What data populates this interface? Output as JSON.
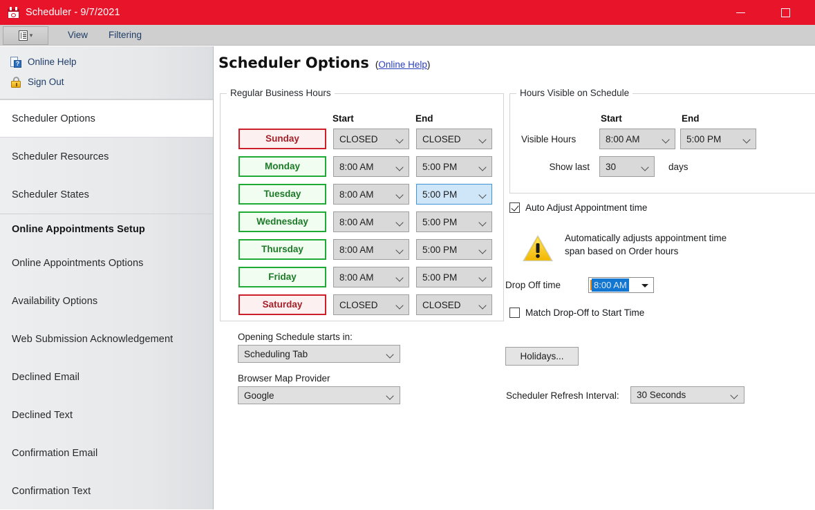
{
  "window": {
    "title": "Scheduler - 9/7/2021",
    "icon": "calendar-icon",
    "minimize_label": "",
    "maximize_label": ""
  },
  "menubar": {
    "app_button_icon": "application-menu-icon",
    "items": [
      {
        "label": "View"
      },
      {
        "label": "Filtering"
      }
    ]
  },
  "sidebar": {
    "quicklinks": [
      {
        "label": "Online Help",
        "icon": "help-document-icon"
      },
      {
        "label": "Sign Out",
        "icon": "padlock-icon"
      }
    ],
    "items": [
      {
        "label": "Scheduler Options",
        "selected": true,
        "header": false
      },
      {
        "label": "Scheduler Resources",
        "selected": false,
        "header": false
      },
      {
        "label": "Scheduler States",
        "selected": false,
        "header": false
      },
      {
        "label": "Online Appointments Setup",
        "selected": false,
        "header": true
      },
      {
        "label": "Online Appointments Options",
        "selected": false,
        "header": false
      },
      {
        "label": "Availability Options",
        "selected": false,
        "header": false
      },
      {
        "label": "Web Submission Acknowledgement",
        "selected": false,
        "header": false
      },
      {
        "label": "Declined Email",
        "selected": false,
        "header": false
      },
      {
        "label": "Declined Text",
        "selected": false,
        "header": false
      },
      {
        "label": "Confirmation Email",
        "selected": false,
        "header": false
      },
      {
        "label": "Confirmation Text",
        "selected": false,
        "header": false
      }
    ]
  },
  "page": {
    "title": "Scheduler Options",
    "help_open_paren": "(",
    "help_link": "Online Help",
    "help_close_paren": ")"
  },
  "business_hours": {
    "legend": "Regular Business Hours",
    "col_start": "Start",
    "col_end": "End",
    "rows": [
      {
        "day": "Sunday",
        "closed": true,
        "start": "CLOSED",
        "end": "CLOSED",
        "end_focused": false
      },
      {
        "day": "Monday",
        "closed": false,
        "start": "8:00 AM",
        "end": "5:00 PM",
        "end_focused": false
      },
      {
        "day": "Tuesday",
        "closed": false,
        "start": "8:00 AM",
        "end": "5:00 PM",
        "end_focused": true
      },
      {
        "day": "Wednesday",
        "closed": false,
        "start": "8:00 AM",
        "end": "5:00 PM",
        "end_focused": false
      },
      {
        "day": "Thursday",
        "closed": false,
        "start": "8:00 AM",
        "end": "5:00 PM",
        "end_focused": false
      },
      {
        "day": "Friday",
        "closed": false,
        "start": "8:00 AM",
        "end": "5:00 PM",
        "end_focused": false
      },
      {
        "day": "Saturday",
        "closed": true,
        "start": "CLOSED",
        "end": "CLOSED",
        "end_focused": false
      }
    ]
  },
  "hours_visible": {
    "legend": "Hours Visible on Schedule",
    "col_start": "Start",
    "col_end": "End",
    "visible_hours_label": "Visible Hours",
    "visible_start": "8:00 AM",
    "visible_end": "5:00 PM",
    "show_last_label": "Show last",
    "show_last_value": "30",
    "days_label": "days"
  },
  "auto_adjust": {
    "checkbox_label": "Auto Adjust Appointment time",
    "checked": true,
    "warning_icon": "warning-triangle-icon",
    "description_line1": "Automatically adjusts appointment time",
    "description_line2": "span based on Order hours",
    "dropoff_label": "Drop Off time",
    "dropoff_value": "8:00 AM",
    "match_checkbox_label": "Match Drop-Off to Start Time",
    "match_checked": false
  },
  "bottom": {
    "opening_schedule_label": "Opening Schedule starts in:",
    "opening_schedule_value": "Scheduling Tab",
    "map_provider_label": "Browser Map Provider",
    "map_provider_value": "Google",
    "holidays_button": "Holidays...",
    "refresh_label": "Scheduler Refresh Interval:",
    "refresh_value": "30 Seconds"
  },
  "colors": {
    "titlebar": "#e8152a",
    "open_day_border": "#1faa35",
    "closed_day_border": "#cc1f2a",
    "focus_blue": "#3f94d8",
    "link_blue": "#2b3fbf"
  }
}
